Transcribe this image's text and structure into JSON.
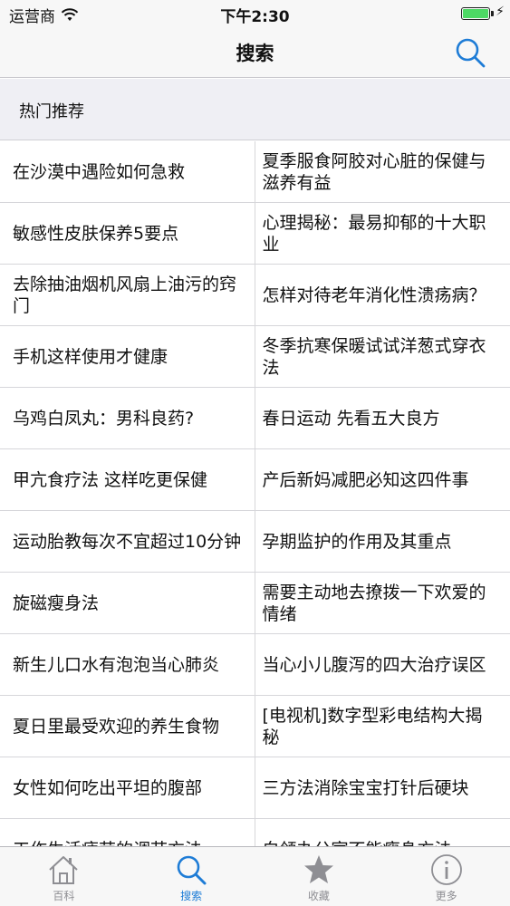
{
  "status_bar": {
    "carrier": "运营商",
    "time": "下午2:30",
    "battery_level": 1.0
  },
  "nav": {
    "title": "搜索",
    "search_icon": "search-icon"
  },
  "section": {
    "title": "热门推荐"
  },
  "articles": [
    [
      "在沙漠中遇险如何急救",
      "夏季服食阿胶对心脏的保健与滋养有益"
    ],
    [
      "敏感性皮肤保养5要点",
      "心理揭秘：最易抑郁的十大职业"
    ],
    [
      "去除抽油烟机风扇上油污的窍门",
      "怎样对待老年消化性溃疡病？"
    ],
    [
      "手机这样使用才健康",
      "冬季抗寒保暖试试洋葱式穿衣法"
    ],
    [
      "乌鸡白凤丸：男科良药?",
      "春日运动 先看五大良方"
    ],
    [
      "甲亢食疗法 这样吃更保健",
      "产后新妈减肥必知这四件事"
    ],
    [
      "运动胎教每次不宜超过10分钟",
      "孕期监护的作用及其重点"
    ],
    [
      "旋磁瘦身法",
      "需要主动地去撩拨一下欢爱的情绪"
    ],
    [
      "新生儿口水有泡泡当心肺炎",
      "当心小儿腹泻的四大治疗误区"
    ],
    [
      "夏日里最受欢迎的养生食物",
      "[电视机]数字型彩电结构大揭秘"
    ],
    [
      "女性如何吃出平坦的腹部",
      "三方法消除宝宝打针后硬块"
    ],
    [
      "工作生活疲劳的调节方法",
      "白领办公室不能瘦身方法"
    ]
  ],
  "tabs": [
    {
      "label": "百科",
      "icon": "home-icon"
    },
    {
      "label": "搜索",
      "icon": "search-icon",
      "active": true
    },
    {
      "label": "收藏",
      "icon": "star-icon"
    },
    {
      "label": "更多",
      "icon": "info-icon"
    }
  ],
  "colors": {
    "accent": "#1e7cd6",
    "inactive": "#8e8e93",
    "battery": "#4cd964"
  }
}
